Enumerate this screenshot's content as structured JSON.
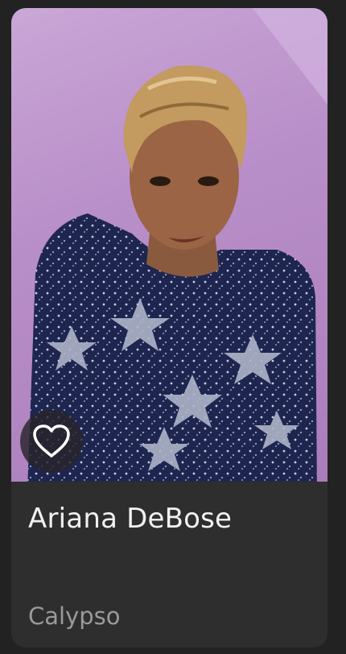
{
  "card": {
    "name": "Ariana DeBose",
    "subtitle": "Calypso",
    "photo_icon": "portrait-photo",
    "favorite_icon": "heart-outline-icon"
  },
  "colors": {
    "page_background": "#222222",
    "card_background": "#2e2e2e",
    "title_text": "#f1f1f1",
    "subtitle_text": "#9a9a9a",
    "photo_background": "#b98fc9"
  }
}
